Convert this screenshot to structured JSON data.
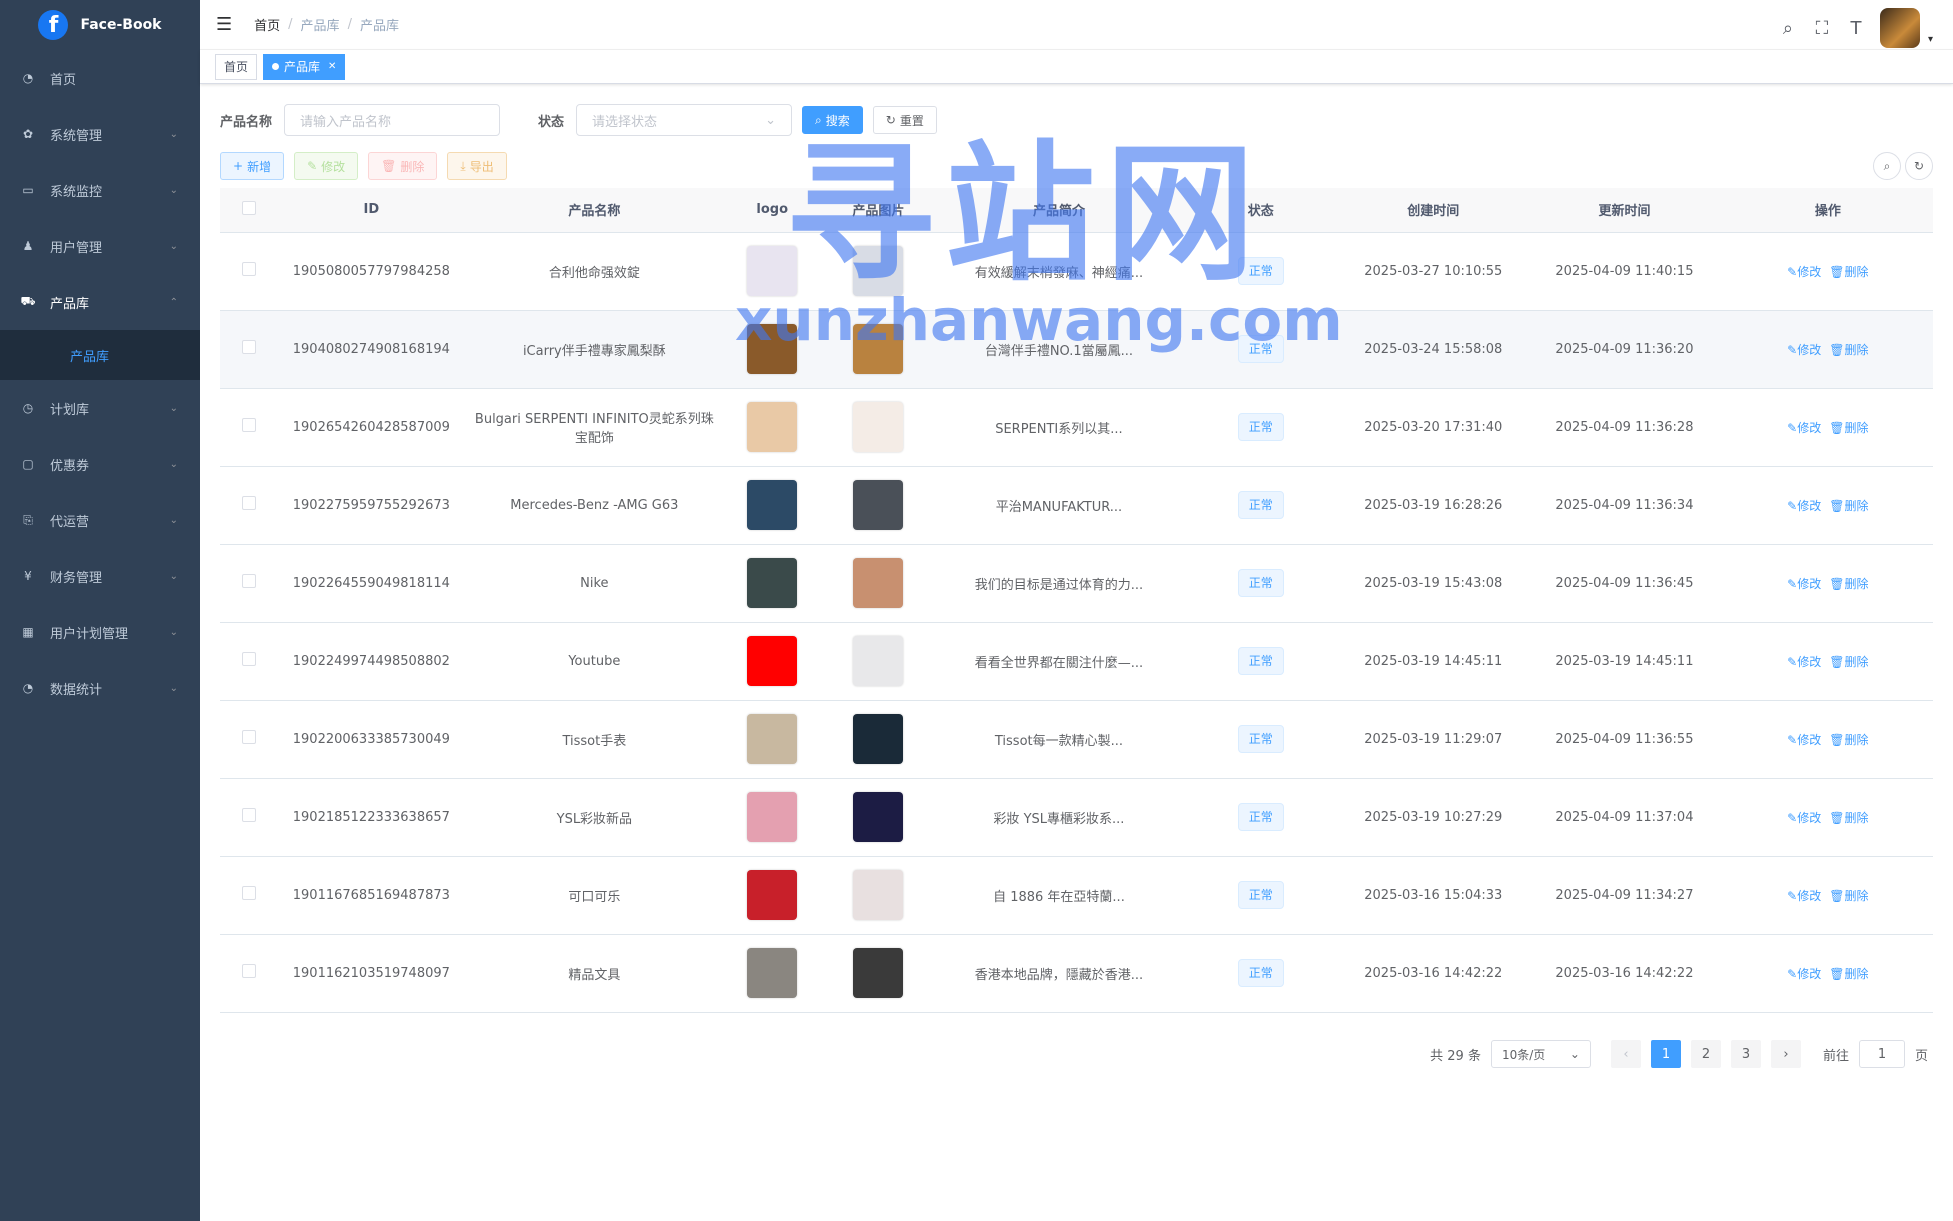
{
  "app": {
    "title": "Face-Book",
    "logo_letter": "f"
  },
  "sidebar": {
    "items": [
      {
        "label": "首页",
        "icon": "dashboard-icon",
        "glyph": "◔",
        "chev": ""
      },
      {
        "label": "系统管理",
        "icon": "gear-icon",
        "glyph": "✿",
        "chev": "⌄"
      },
      {
        "label": "系统监控",
        "icon": "monitor-icon",
        "glyph": "▭",
        "chev": "⌄"
      },
      {
        "label": "用户管理",
        "icon": "user-icon",
        "glyph": "♟",
        "chev": "⌄"
      },
      {
        "label": "产品库",
        "icon": "cart-icon",
        "glyph": "⛟",
        "chev": "⌃"
      },
      {
        "label": "计划库",
        "icon": "clock-icon",
        "glyph": "◷",
        "chev": "⌄"
      },
      {
        "label": "优惠券",
        "icon": "coupon-icon",
        "glyph": "▢",
        "chev": "⌄"
      },
      {
        "label": "代运营",
        "icon": "operation-icon",
        "glyph": "⎘",
        "chev": "⌄"
      },
      {
        "label": "财务管理",
        "icon": "yen-icon",
        "glyph": "¥",
        "chev": "⌄"
      },
      {
        "label": "用户计划管理",
        "icon": "grid-icon",
        "glyph": "▦",
        "chev": "⌄"
      },
      {
        "label": "数据统计",
        "icon": "chart-icon",
        "glyph": "◔",
        "chev": "⌄"
      }
    ],
    "submenu": "产品库"
  },
  "breadcrumb": [
    "首页",
    "产品库",
    "产品库"
  ],
  "tags": [
    {
      "label": "首页"
    },
    {
      "label": "产品库"
    }
  ],
  "search": {
    "name_label": "产品名称",
    "name_placeholder": "请输入产品名称",
    "status_label": "状态",
    "status_placeholder": "请选择状态",
    "search_btn": "搜索",
    "reset_btn": "重置"
  },
  "toolbar": {
    "add": "新增",
    "edit": "修改",
    "delete": "删除",
    "export": "导出"
  },
  "table": {
    "headers": [
      "",
      "ID",
      "产品名称",
      "logo",
      "产品图片",
      "产品简介",
      "状态",
      "创建时间",
      "更新时间",
      "操作"
    ],
    "rows": [
      {
        "id": "1905080057797984258",
        "name": "合利他命强效錠",
        "desc": "有效緩解末梢發麻、神經痛...",
        "status": "正常",
        "created": "2025-03-27 10:10:55",
        "updated": "2025-04-09 11:40:15",
        "logo": "#e8e4f0",
        "img": "#d8dce5"
      },
      {
        "id": "1904080274908168194",
        "name": "iCarry伴手禮專家鳳梨酥",
        "desc": "台灣伴手禮NO.1當屬鳳...",
        "status": "正常",
        "created": "2025-03-24 15:58:08",
        "updated": "2025-04-09 11:36:20",
        "logo": "#8a5a2a",
        "img": "#b9823f"
      },
      {
        "id": "1902654260428587009",
        "name": "Bulgari SERPENTI INFINITO灵蛇系列珠宝配饰",
        "desc": "SERPENTI系列以其...",
        "status": "正常",
        "created": "2025-03-20 17:31:40",
        "updated": "2025-04-09 11:36:28",
        "logo": "#e9c9a6",
        "img": "#f4ece6"
      },
      {
        "id": "1902275959755292673",
        "name": "Mercedes-Benz -AMG G63",
        "desc": "平治MANUFAKTUR...",
        "status": "正常",
        "created": "2025-03-19 16:28:26",
        "updated": "2025-04-09 11:36:34",
        "logo": "#2c4a66",
        "img": "#4a5058"
      },
      {
        "id": "1902264559049818114",
        "name": "Nike",
        "desc": "我们的目标是通过体育的力...",
        "status": "正常",
        "created": "2025-03-19 15:43:08",
        "updated": "2025-04-09 11:36:45",
        "logo": "#3a4a4a",
        "img": "#c89070"
      },
      {
        "id": "1902249974498508802",
        "name": "Youtube",
        "desc": "看看全世界都在關注什麼—...",
        "status": "正常",
        "created": "2025-03-19 14:45:11",
        "updated": "2025-03-19 14:45:11",
        "logo": "#ff0000",
        "img": "#e8e8ea"
      },
      {
        "id": "1902200633385730049",
        "name": "Tissot手表",
        "desc": "Tissot每一款精心製...",
        "status": "正常",
        "created": "2025-03-19 11:29:07",
        "updated": "2025-04-09 11:36:55",
        "logo": "#c8b8a0",
        "img": "#1a2a38"
      },
      {
        "id": "1902185122333638657",
        "name": "YSL彩妝新品",
        "desc": "彩妝 YSL專櫃彩妝系...",
        "status": "正常",
        "created": "2025-03-19 10:27:29",
        "updated": "2025-04-09 11:37:04",
        "logo": "#e4a0b0",
        "img": "#1c1c44"
      },
      {
        "id": "1901167685169487873",
        "name": "可口可乐",
        "desc": "自 1886 年在亞特蘭...",
        "status": "正常",
        "created": "2025-03-16 15:04:33",
        "updated": "2025-04-09 11:34:27",
        "logo": "#c8202a",
        "img": "#e8e0e0"
      },
      {
        "id": "1901162103519748097",
        "name": "精品文具",
        "desc": "香港本地品牌，隱藏於香港...",
        "status": "正常",
        "created": "2025-03-16 14:42:22",
        "updated": "2025-03-16 14:42:22",
        "logo": "#8a8680",
        "img": "#3a3a3a"
      }
    ],
    "edit_label": "修改",
    "delete_label": "删除"
  },
  "pagination": {
    "total": "共 29 条",
    "page_size": "10条/页",
    "pages": [
      "1",
      "2",
      "3"
    ],
    "current": "1",
    "goto_label": "前往",
    "goto_value": "1",
    "goto_suffix": "页"
  },
  "watermark": {
    "cn": "寻站网",
    "en": "xunzhanwang.com"
  }
}
